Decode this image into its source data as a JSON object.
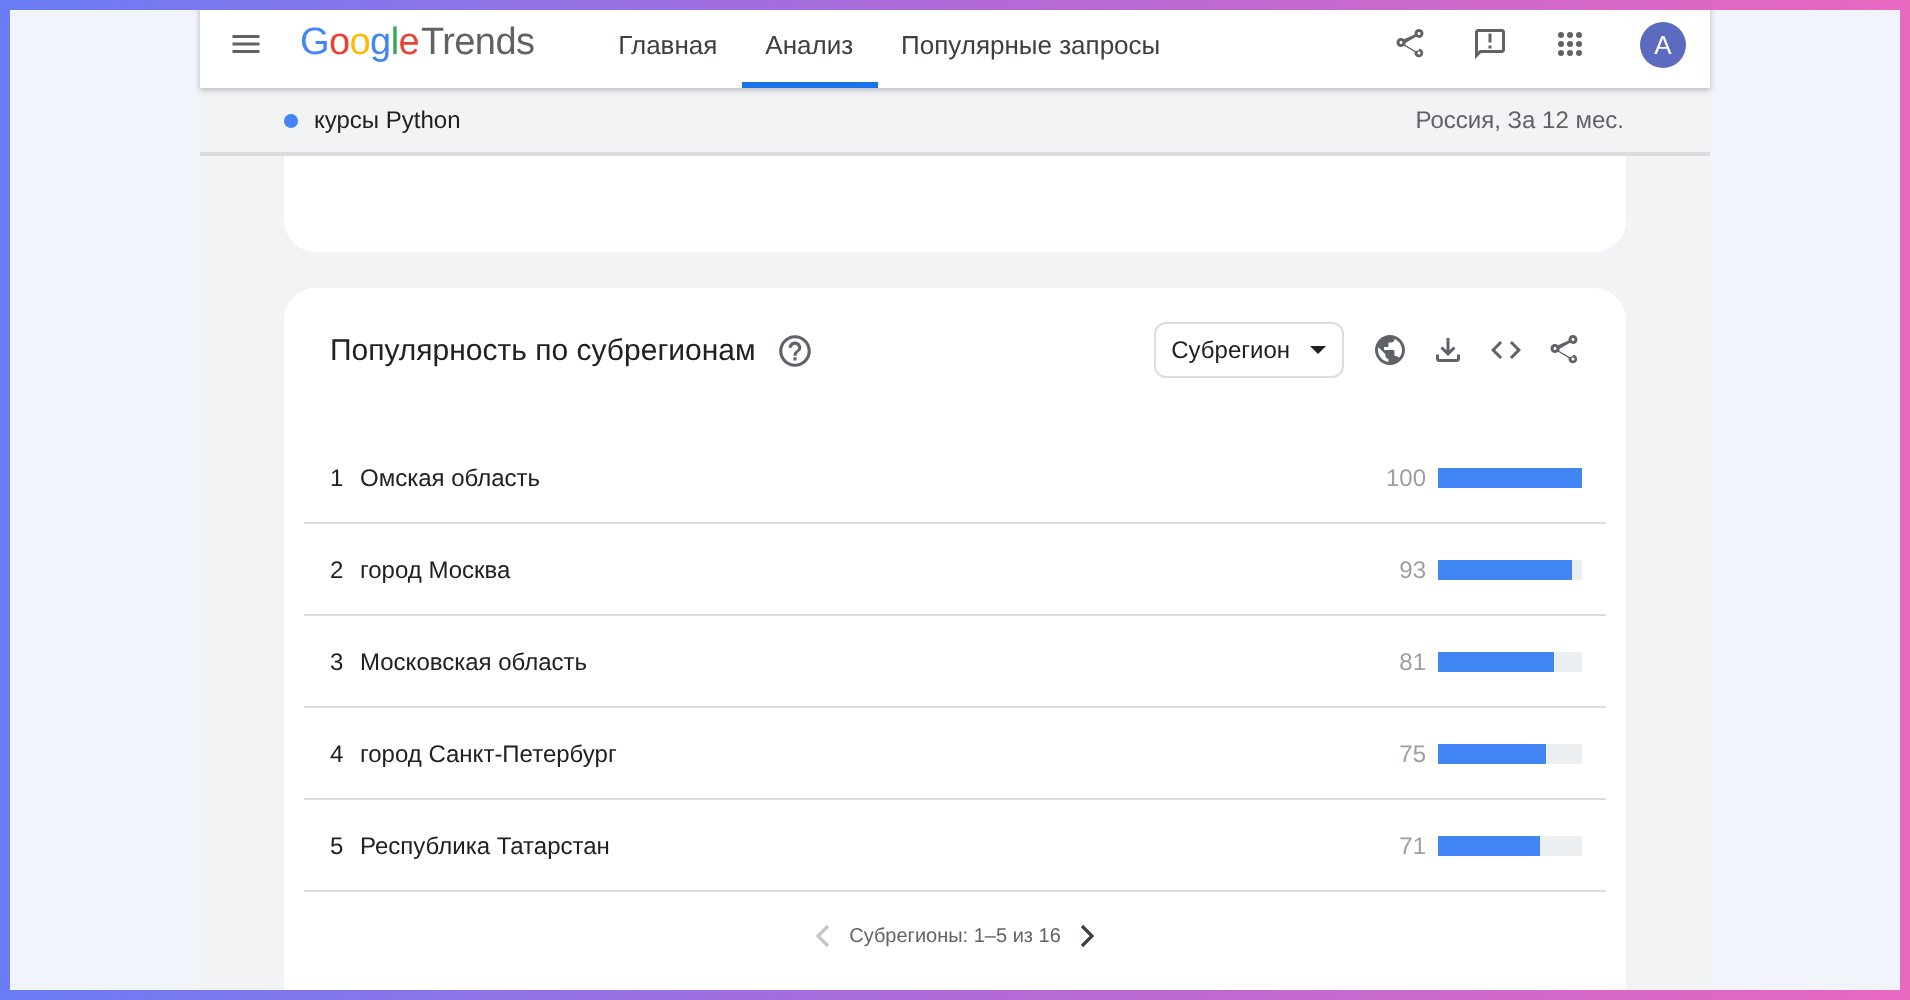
{
  "header": {
    "logo": {
      "brand": "Google",
      "product": "Trends"
    },
    "nav": [
      {
        "label": "Главная",
        "selected": false
      },
      {
        "label": "Анализ",
        "selected": true
      },
      {
        "label": "Популярные запросы",
        "selected": false
      }
    ],
    "avatar": "A"
  },
  "query_bar": {
    "term": {
      "label": "курсы Python",
      "color": "#4285f4"
    },
    "scope": "Россия, За 12 мес."
  },
  "regions_card": {
    "title": "Популярность по субрегионам",
    "dropdown": "Субрегион",
    "rows": [
      {
        "rank": "1",
        "name": "Омская область",
        "value": "100",
        "level": 1.0
      },
      {
        "rank": "2",
        "name": "город Москва",
        "value": "93",
        "level": 0.93
      },
      {
        "rank": "3",
        "name": "Московская область",
        "value": "81",
        "level": 0.81
      },
      {
        "rank": "4",
        "name": "город Санкт-Петербург",
        "value": "75",
        "level": 0.75
      },
      {
        "rank": "5",
        "name": "Республика Татарстан",
        "value": "71",
        "level": 0.71
      }
    ],
    "pagination": {
      "label": "Субрегионы: 1–5 из 16",
      "prev_disabled": true,
      "next_disabled": false
    }
  }
}
